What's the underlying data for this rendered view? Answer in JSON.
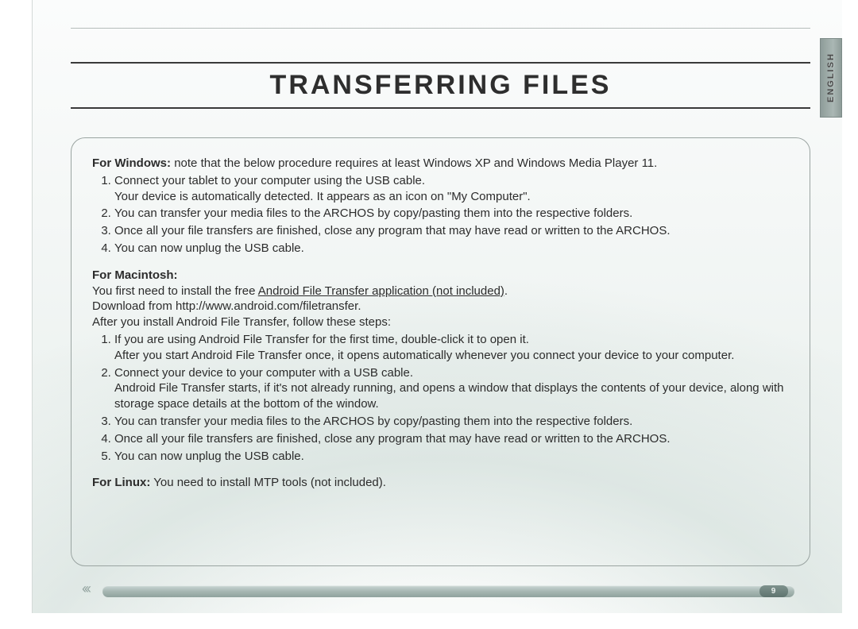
{
  "sideTab": "ENGLISH",
  "title": "TRANSFERRING FILES",
  "windows": {
    "label": "For Windows:",
    "note": "note that the below procedure requires at least Windows XP and Windows Media Player 11.",
    "steps": [
      "Connect your tablet to your computer using the USB cable.\nYour device is automatically detected. It appears as an icon on \"My Computer\".",
      "You can transfer your media files to the ARCHOS by copy/pasting them into the respective folders.",
      "Once all your file transfers are finished, close any program that may have read or written to the ARCHOS.",
      "You can now unplug the USB cable."
    ]
  },
  "mac": {
    "label": "For Macintosh:",
    "intro1_a": "You first need to install the free ",
    "intro1_link": "Android File Transfer application (not included)",
    "intro1_b": ".",
    "intro2": "Download from http://www.android.com/filetransfer.",
    "intro3": "After you install Android File Transfer, follow these steps:",
    "steps": [
      "If you are using Android File Transfer for the first time, double-click it to open it.\nAfter you start Android File Transfer once, it opens automatically whenever you connect your device to your computer.",
      "Connect your device to your computer with a USB cable.\nAndroid File Transfer starts, if it's not already running, and opens a window that displays the contents of your device, along with storage space details at the bottom of the window.",
      "You can transfer your media files to the ARCHOS by copy/pasting them into the respective folders.",
      "Once all your file transfers are finished, close any program that may have read or written to the ARCHOS.",
      "You can now unplug the USB cable."
    ]
  },
  "linux": {
    "label": "For Linux:",
    "text": "You need to install MTP tools (not included)."
  },
  "pageNumber": "9",
  "spineGlyph": "‹‹‹"
}
